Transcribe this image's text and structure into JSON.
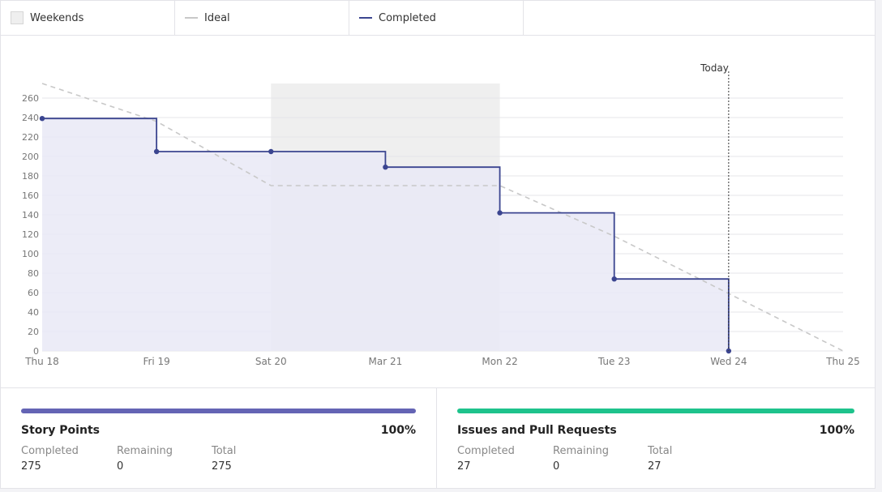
{
  "legend": {
    "weekends": "Weekends",
    "ideal": "Ideal",
    "completed": "Completed"
  },
  "colors": {
    "completed_line": "#3b4590",
    "completed_fill": "#e9e9f6",
    "ideal_line": "#c8c8c8",
    "weekend_fill": "#efefef",
    "story_bar": "#6464b4",
    "issues_bar": "#1ec38c"
  },
  "chart_data": {
    "type": "line",
    "x": [
      "Thu 18",
      "Fri 19",
      "Sat 20",
      "Mar 21",
      "Mon 22",
      "Tue 23",
      "Wed 24",
      "Thu 25"
    ],
    "ylim": [
      0,
      260
    ],
    "yticks": [
      0,
      20,
      40,
      60,
      80,
      100,
      120,
      140,
      160,
      180,
      200,
      220,
      240,
      260
    ],
    "grid": true,
    "weekend_range": [
      "Sat 20",
      "Mon 22"
    ],
    "today_marker": {
      "label": "Today",
      "x": "Wed 24"
    },
    "series": [
      {
        "name": "Completed",
        "step": true,
        "values": [
          239,
          205,
          205,
          189,
          142,
          74,
          0
        ]
      },
      {
        "name": "Ideal",
        "dashed": true,
        "values": [
          275,
          236,
          170,
          170,
          170,
          118,
          59,
          0
        ]
      }
    ]
  },
  "cards": [
    {
      "title": "Story Points",
      "percent": "100%",
      "progress": 1.0,
      "completed_label": "Completed",
      "completed": "275",
      "remaining_label": "Remaining",
      "remaining": "0",
      "total_label": "Total",
      "total": "275"
    },
    {
      "title": "Issues and Pull Requests",
      "percent": "100%",
      "progress": 1.0,
      "completed_label": "Completed",
      "completed": "27",
      "remaining_label": "Remaining",
      "remaining": "0",
      "total_label": "Total",
      "total": "27"
    }
  ]
}
